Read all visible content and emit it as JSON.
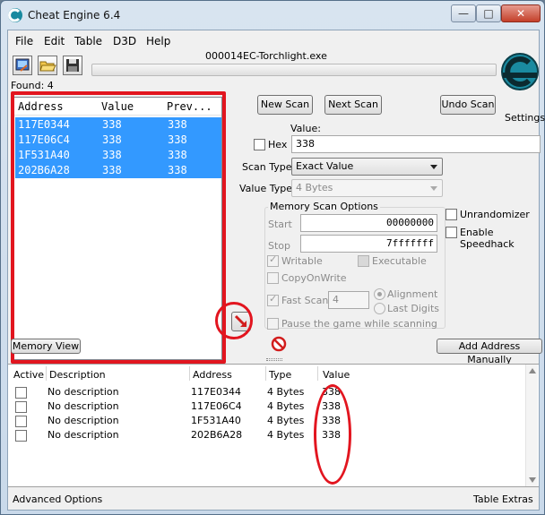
{
  "window": {
    "title": "Cheat Engine 6.4",
    "controls": {
      "minimize": "—",
      "maximize": "□",
      "close": "✕"
    }
  },
  "menu": [
    "File",
    "Edit",
    "Table",
    "D3D",
    "Help"
  ],
  "toolbar": {
    "process_title": "000014EC-Torchlight.exe",
    "icons": [
      "open-process-icon",
      "open-file-icon",
      "save-icon"
    ]
  },
  "found": "Found: 4",
  "results": {
    "headers": [
      "Address",
      "Value",
      "Prev..."
    ],
    "rows": [
      {
        "address": "117E0344",
        "value": "338",
        "previous": "338"
      },
      {
        "address": "117E06C4",
        "value": "338",
        "previous": "338"
      },
      {
        "address": "1F531A40",
        "value": "338",
        "previous": "338"
      },
      {
        "address": "202B6A28",
        "value": "338",
        "previous": "338"
      }
    ]
  },
  "scan": {
    "new_scan": "New Scan",
    "next_scan": "Next Scan",
    "undo_scan": "Undo Scan",
    "settings": "Settings",
    "value_label": "Value:",
    "hex_label": "Hex",
    "value": "338",
    "scan_type_label": "Scan Type",
    "scan_type": "Exact Value",
    "value_type_label": "Value Type",
    "value_type": "4 Bytes"
  },
  "memory_options": {
    "title": "Memory Scan Options",
    "start_label": "Start",
    "start": "00000000",
    "stop_label": "Stop",
    "stop": "7fffffff",
    "writable": "Writable",
    "executable": "Executable",
    "copy_on_write": "CopyOnWrite",
    "fast_scan": "Fast Scan",
    "fast_scan_value": "4",
    "alignment": "Alignment",
    "last_digits": "Last Digits",
    "pause": "Pause the game while scanning"
  },
  "extras": {
    "unrandomizer": "Unrandomizer",
    "speedhack": "Enable Speedhack"
  },
  "actions": {
    "memory_view": "Memory View",
    "add_manually": "Add Address Manually"
  },
  "address_table": {
    "headers": [
      "Active",
      "Description",
      "Address",
      "Type",
      "Value"
    ],
    "rows": [
      {
        "description": "No description",
        "address": "117E0344",
        "type": "4 Bytes",
        "value": "338"
      },
      {
        "description": "No description",
        "address": "117E06C4",
        "type": "4 Bytes",
        "value": "338"
      },
      {
        "description": "No description",
        "address": "1F531A40",
        "type": "4 Bytes",
        "value": "338"
      },
      {
        "description": "No description",
        "address": "202B6A28",
        "type": "4 Bytes",
        "value": "338"
      }
    ]
  },
  "status": {
    "advanced": "Advanced Options",
    "extras": "Table Extras"
  },
  "colors": {
    "selection": "#3399ff",
    "annotation": "#e2151f",
    "logo": "#1a8aa0"
  }
}
